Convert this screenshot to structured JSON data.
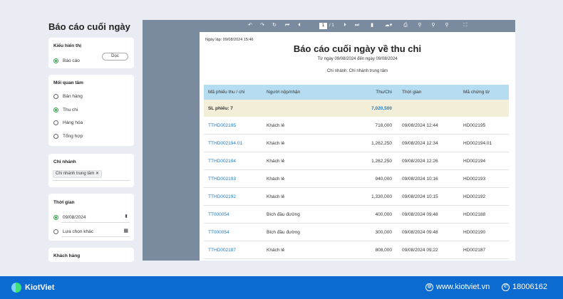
{
  "page_title": "Báo cáo cuối ngày",
  "display_type": {
    "title": "Kiểu hiển thị",
    "option": "Báo cáo",
    "toggle_label": "Dọc"
  },
  "concern": {
    "title": "Mối quan tâm",
    "options": [
      "Bán hàng",
      "Thu chi",
      "Hàng hóa",
      "Tổng hợp"
    ],
    "selected": "Thu chi"
  },
  "branch": {
    "title": "Chi nhánh",
    "chip": "Chi nhánh trung tâm"
  },
  "time": {
    "title": "Thời gian",
    "date": "09/08/2024",
    "custom": "Lựa chọn khác"
  },
  "customer": {
    "title": "Khách hàng"
  },
  "toolbar": {
    "page_current": "1",
    "page_total": "/ 1",
    "icons": [
      "undo-icon",
      "redo-icon",
      "refresh-icon",
      "first-page-icon",
      "prev-page-icon",
      "next-page-icon",
      "last-page-icon",
      "document-icon",
      "cloud-export-icon",
      "print-icon",
      "zoom-icon",
      "zoom-in-icon",
      "zoom-out-icon",
      "fullscreen-icon"
    ]
  },
  "report": {
    "timestamp": "Ngày lập: 09/08/2024 15:46",
    "title": "Báo cáo cuối ngày về thu chi",
    "date_range": "Từ ngày 09/08/2024 đến ngày 09/08/2024",
    "branch": "Chi nhánh: Chi nhánh trung tâm",
    "columns": [
      "Mã phiếu thu / chi",
      "Người nộp/nhận",
      "Thu/Chi",
      "Thời gian",
      "Mã chứng từ"
    ],
    "summary": {
      "label": "SL phiếu: 7",
      "total": "7,020,500"
    },
    "rows": [
      {
        "code": "TTHD002195",
        "person": "Khách lẻ",
        "amount": "718,000",
        "time": "09/08/2024 12:44",
        "doc": "HD002195"
      },
      {
        "code": "TTHD002194.01",
        "person": "Khách lẻ",
        "amount": "1,262,250",
        "time": "09/08/2024 12:34",
        "doc": "HD002194.01"
      },
      {
        "code": "TTHD002194",
        "person": "Khách lẻ",
        "amount": "1,262,250",
        "time": "09/08/2024 12:26",
        "doc": "HD002194"
      },
      {
        "code": "TTHD002193",
        "person": "Khách lẻ",
        "amount": "940,000",
        "time": "09/08/2024 10:16",
        "doc": "HD002193"
      },
      {
        "code": "TTHD002192",
        "person": "Khách lẻ",
        "amount": "1,330,000",
        "time": "09/08/2024 10:15",
        "doc": "HD002192"
      },
      {
        "code": "TT000054",
        "person": "Bích đầu đường",
        "amount": "400,000",
        "time": "09/08/2024 09:48",
        "doc": "HD002188"
      },
      {
        "code": "TT000054",
        "person": "Bích đầu đường",
        "amount": "300,000",
        "time": "09/08/2024 09:48",
        "doc": "HD002190"
      },
      {
        "code": "TTHD002187",
        "person": "Khách lẻ",
        "amount": "808,000",
        "time": "09/08/2024 09:22",
        "doc": "HD002187"
      }
    ]
  },
  "footer": {
    "brand": "KiotViet",
    "website": "www.kiotviet.vn",
    "phone": "18006162"
  },
  "colors": {
    "footer_bg": "#0b6bd0",
    "header_row": "#b5dcf0",
    "summary_row": "#f3eed8",
    "link": "#1f7bc4",
    "accent_green": "#27a844"
  }
}
